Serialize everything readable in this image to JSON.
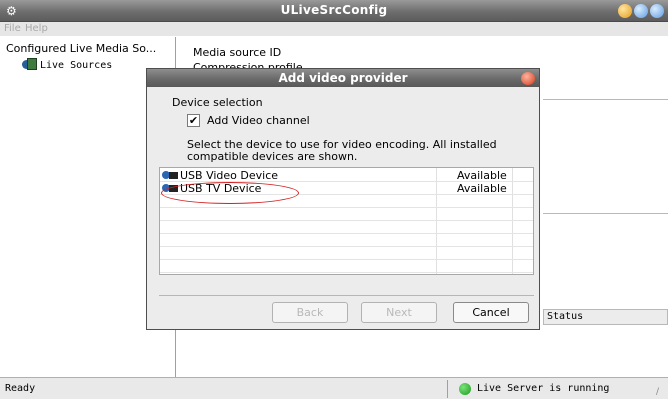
{
  "window": {
    "title": "ULiveSrcConfig",
    "menu": [
      "File",
      "Help"
    ]
  },
  "tree": {
    "root_label": "Configured Live Media So...",
    "child_label": "Live Sources"
  },
  "details": {
    "media_source_label": "Media source ID",
    "compression_label": "Compression profile",
    "status_column": "Status"
  },
  "dialog": {
    "title": "Add video provider",
    "section_label": "Device selection",
    "checkbox_label": "Add Video channel",
    "checkbox_checked": true,
    "instructions": "Select the device to use for video encoding. All installed compatible devices are shown.",
    "devices": [
      {
        "name": "USB Video Device",
        "status": "Available"
      },
      {
        "name": "USB TV Device",
        "status": "Available"
      }
    ],
    "buttons": {
      "back": "Back",
      "next": "Next",
      "cancel": "Cancel"
    }
  },
  "statusbar": {
    "left": "Ready",
    "right": "Live Server is running"
  },
  "colors": {
    "highlight_ellipse": "#d42020",
    "server_indicator": "#1b9a1b"
  }
}
